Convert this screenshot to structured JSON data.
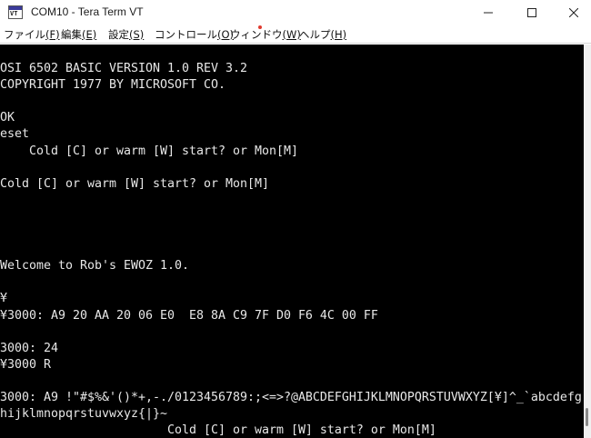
{
  "window": {
    "title": "COM10 - Tera Term VT",
    "icon_text": "VT"
  },
  "menu": [
    {
      "label": "ファイル",
      "accel": "(F)"
    },
    {
      "label": "編集",
      "accel": "(E)"
    },
    {
      "label": "設定",
      "accel": "(S)"
    },
    {
      "label": "コントロール",
      "accel": "(O)"
    },
    {
      "label": "ウィンドウ",
      "accel": "(W)"
    },
    {
      "label": "ヘルプ",
      "accel": "(H)"
    }
  ],
  "terminal": {
    "lines": [
      "OSI 6502 BASIC VERSION 1.0 REV 3.2",
      "COPYRIGHT 1977 BY MICROSOFT CO.",
      "",
      "OK",
      "eset",
      "    Cold [C] or warm [W] start? or Mon[M]",
      "",
      "Cold [C] or warm [W] start? or Mon[M]",
      "",
      "",
      "",
      "",
      "Welcome to Rob's EWOZ 1.0.",
      "",
      "¥",
      "¥3000: A9 20 AA 20 06 E0  E8 8A C9 7F D0 F6 4C 00 FF",
      "",
      "3000: 24",
      "¥3000 R",
      "",
      "3000: A9 !\"#$%&'()*+,-./0123456789:;<=>?@ABCDEFGHIJKLMNOPQRSTUVWXYZ[¥]^_`abcdefg",
      "hijklmnopqrstuvwxyz{|}~",
      "                       Cold [C] or warm [W] start? or Mon[M]"
    ]
  },
  "colors": {
    "terminal_bg": "#000000",
    "terminal_fg": "#e8e8e8",
    "cursor": "#ffffff"
  }
}
